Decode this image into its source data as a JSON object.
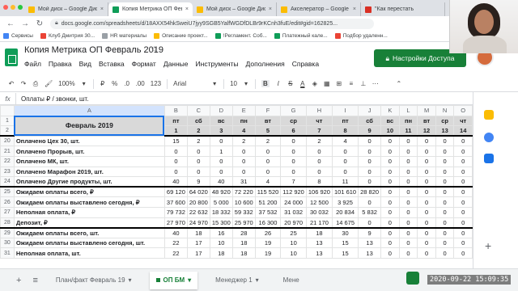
{
  "browser": {
    "tabs": [
      {
        "title": "Мой диск – Google Диск",
        "color": "#fbbc04",
        "active": false
      },
      {
        "title": "Копия Метрика ОП Февраль",
        "color": "#0f9d58",
        "active": true
      },
      {
        "title": "Мой диск – Google Диск",
        "color": "#fbbc04",
        "active": false
      },
      {
        "title": "Акселератор – Google Диск",
        "color": "#fbbc04",
        "active": false
      },
      {
        "title": "\"Как перестать",
        "color": "#d93025",
        "active": false
      }
    ],
    "close_glyph": "×",
    "new_tab": "+",
    "url": "docs.google.com/spreadsheets/d/18AXX54hkSweiU7jyy9SGB5YalfWGDfDLBr9rKCnh3fuE/edit#gid=162825...",
    "bookmarks": [
      {
        "label": "Сервисы",
        "color": "#4285f4"
      },
      {
        "label": "Клуб Дмитрия 30...",
        "color": "#ea4335"
      },
      {
        "label": "HR материалы",
        "color": "#9aa0a6"
      },
      {
        "label": "Описание проект...",
        "color": "#fbbc04"
      },
      {
        "label": "!Регламент. Соб...",
        "color": "#0f9d58"
      },
      {
        "label": "Платежный кале...",
        "color": "#0f9d58"
      },
      {
        "label": "Подбор удаленн...",
        "color": "#ea4335"
      }
    ]
  },
  "doc": {
    "title": "Копия Метрика ОП Февраль 2019",
    "star": "☆",
    "menu": [
      "Файл",
      "Правка",
      "Вид",
      "Вставка",
      "Формат",
      "Данные",
      "Инструменты",
      "Дополнения",
      "Справка"
    ],
    "share_label": "Настройки Доступа",
    "share_icon": "lock-icon"
  },
  "toolbar": {
    "zoom": "100%",
    "currency": "₽",
    "percent": "%",
    "dec_less": ".0",
    "dec_more": ".00",
    "format_more": "123",
    "font": "Arial",
    "font_size": "10",
    "bold": "B",
    "italic": "I",
    "strike": "S",
    "text_color": "A"
  },
  "formula": {
    "fx": "fx",
    "value": "Оплаты ₽ / звонки, шт."
  },
  "sheet": {
    "columns": [
      "A",
      "B",
      "C",
      "D",
      "E",
      "F",
      "G",
      "H",
      "I",
      "J",
      "K",
      "L",
      "M",
      "N",
      "O"
    ],
    "month_label": "Февраль 2019",
    "weekdays": [
      "пт",
      "сб",
      "вс",
      "пн",
      "вт",
      "ср",
      "чт",
      "пт",
      "сб",
      "вс",
      "пн",
      "вт",
      "ср",
      "чт"
    ],
    "days": [
      "1",
      "2",
      "3",
      "4",
      "5",
      "6",
      "7",
      "8",
      "9",
      "10",
      "11",
      "12",
      "13",
      "14"
    ],
    "rows": [
      {
        "n": "20",
        "label": "Оплачено Цех 30, шт.",
        "values": [
          "15",
          "2",
          "0",
          "2",
          "2",
          "0",
          "2",
          "4",
          "0",
          "0",
          "0",
          "0",
          "0",
          "0"
        ]
      },
      {
        "n": "21",
        "label": "Оплачено Прорыв, шт.",
        "values": [
          "0",
          "0",
          "1",
          "0",
          "0",
          "0",
          "0",
          "0",
          "0",
          "0",
          "0",
          "0",
          "0",
          "0"
        ]
      },
      {
        "n": "22",
        "label": "Оплачено МК, шт.",
        "values": [
          "0",
          "0",
          "0",
          "0",
          "0",
          "0",
          "0",
          "0",
          "0",
          "0",
          "0",
          "0",
          "0",
          "0"
        ]
      },
      {
        "n": "23",
        "label": "Оплачено Марафон 2019, шт.",
        "values": [
          "0",
          "0",
          "0",
          "0",
          "0",
          "0",
          "0",
          "0",
          "0",
          "0",
          "0",
          "0",
          "0",
          "0"
        ]
      },
      {
        "n": "24",
        "label": "Оплачено Другие продукты, шт.",
        "values": [
          "40",
          "9",
          "40",
          "31",
          "4",
          "7",
          "8",
          "11",
          "0",
          "0",
          "0",
          "0",
          "0",
          "0"
        ]
      },
      {
        "n": "25",
        "label": "Ожидаем оплаты всего, ₽",
        "values": [
          "69 120",
          "64 020",
          "48 920",
          "72 220",
          "115 520",
          "112 920",
          "106 920",
          "101 610",
          "28 820",
          "0",
          "0",
          "0",
          "0",
          "0"
        ]
      },
      {
        "n": "26",
        "label": "Ожидаем оплаты выставлено сегодня, ₽",
        "values": [
          "37 600",
          "20 800",
          "5 000",
          "10 600",
          "51 200",
          "24 000",
          "12 500",
          "3 925",
          "0",
          "0",
          "0",
          "0",
          "0",
          "0"
        ]
      },
      {
        "n": "27",
        "label": "Неполная оплата, ₽",
        "values": [
          "79 732",
          "22 632",
          "18 332",
          "59 332",
          "37 532",
          "31 032",
          "30 032",
          "20 834",
          "5 832",
          "0",
          "0",
          "0",
          "0",
          "0"
        ]
      },
      {
        "n": "28",
        "label": "Депозит, ₽",
        "values": [
          "27 970",
          "24 970",
          "15 300",
          "25 970",
          "16 300",
          "20 970",
          "21 170",
          "14 675",
          "0",
          "0",
          "0",
          "0",
          "0",
          "0"
        ]
      },
      {
        "n": "29",
        "label": "Ожидаем оплаты всего, шт.",
        "values": [
          "40",
          "18",
          "16",
          "28",
          "26",
          "25",
          "18",
          "30",
          "9",
          "0",
          "0",
          "0",
          "0",
          "0"
        ]
      },
      {
        "n": "30",
        "label": "Ожидаем оплаты выставлено сегодня, шт.",
        "values": [
          "22",
          "17",
          "10",
          "18",
          "19",
          "10",
          "13",
          "15",
          "13",
          "0",
          "0",
          "0",
          "0",
          "0"
        ]
      },
      {
        "n": "31",
        "label": "Неполная оплата, шт.",
        "values": [
          "22",
          "17",
          "18",
          "18",
          "19",
          "10",
          "13",
          "15",
          "13",
          "0",
          "0",
          "0",
          "0",
          "0"
        ]
      }
    ]
  },
  "sheet_tabs": {
    "add": "+",
    "list": "≡",
    "tabs": [
      {
        "label": "План/факт Февраль 19",
        "active": false
      },
      {
        "label": "ОП БМ",
        "active": true
      },
      {
        "label": "Менеджер 1",
        "active": false
      },
      {
        "label": "Мене",
        "active": false
      }
    ],
    "dropdown": "▾"
  },
  "timestamp": "2020-09-22  15:09:35",
  "colors": {
    "accent_green": "#188038",
    "selection_blue": "#1a73e8",
    "header_gray": "#d9d9d9"
  }
}
